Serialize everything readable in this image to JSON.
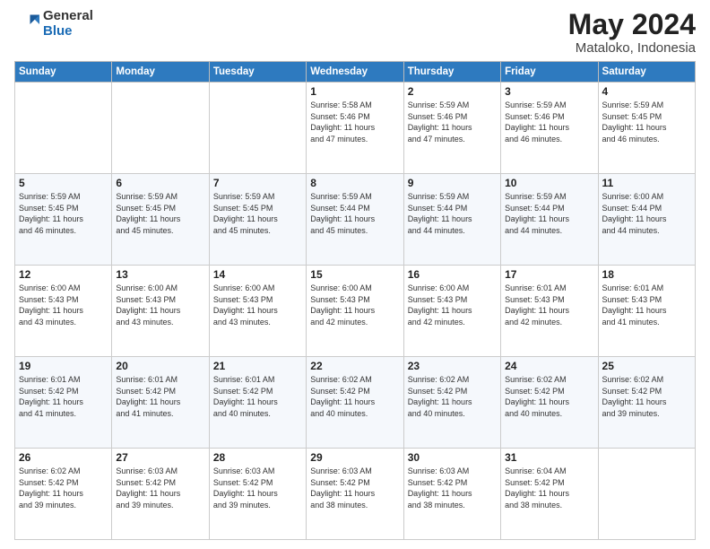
{
  "header": {
    "logo_general": "General",
    "logo_blue": "Blue",
    "title": "May 2024",
    "location": "Mataloko, Indonesia"
  },
  "days_of_week": [
    "Sunday",
    "Monday",
    "Tuesday",
    "Wednesday",
    "Thursday",
    "Friday",
    "Saturday"
  ],
  "weeks": [
    [
      {
        "day": "",
        "text": ""
      },
      {
        "day": "",
        "text": ""
      },
      {
        "day": "",
        "text": ""
      },
      {
        "day": "1",
        "text": "Sunrise: 5:58 AM\nSunset: 5:46 PM\nDaylight: 11 hours\nand 47 minutes."
      },
      {
        "day": "2",
        "text": "Sunrise: 5:59 AM\nSunset: 5:46 PM\nDaylight: 11 hours\nand 47 minutes."
      },
      {
        "day": "3",
        "text": "Sunrise: 5:59 AM\nSunset: 5:46 PM\nDaylight: 11 hours\nand 46 minutes."
      },
      {
        "day": "4",
        "text": "Sunrise: 5:59 AM\nSunset: 5:45 PM\nDaylight: 11 hours\nand 46 minutes."
      }
    ],
    [
      {
        "day": "5",
        "text": "Sunrise: 5:59 AM\nSunset: 5:45 PM\nDaylight: 11 hours\nand 46 minutes."
      },
      {
        "day": "6",
        "text": "Sunrise: 5:59 AM\nSunset: 5:45 PM\nDaylight: 11 hours\nand 45 minutes."
      },
      {
        "day": "7",
        "text": "Sunrise: 5:59 AM\nSunset: 5:45 PM\nDaylight: 11 hours\nand 45 minutes."
      },
      {
        "day": "8",
        "text": "Sunrise: 5:59 AM\nSunset: 5:44 PM\nDaylight: 11 hours\nand 45 minutes."
      },
      {
        "day": "9",
        "text": "Sunrise: 5:59 AM\nSunset: 5:44 PM\nDaylight: 11 hours\nand 44 minutes."
      },
      {
        "day": "10",
        "text": "Sunrise: 5:59 AM\nSunset: 5:44 PM\nDaylight: 11 hours\nand 44 minutes."
      },
      {
        "day": "11",
        "text": "Sunrise: 6:00 AM\nSunset: 5:44 PM\nDaylight: 11 hours\nand 44 minutes."
      }
    ],
    [
      {
        "day": "12",
        "text": "Sunrise: 6:00 AM\nSunset: 5:43 PM\nDaylight: 11 hours\nand 43 minutes."
      },
      {
        "day": "13",
        "text": "Sunrise: 6:00 AM\nSunset: 5:43 PM\nDaylight: 11 hours\nand 43 minutes."
      },
      {
        "day": "14",
        "text": "Sunrise: 6:00 AM\nSunset: 5:43 PM\nDaylight: 11 hours\nand 43 minutes."
      },
      {
        "day": "15",
        "text": "Sunrise: 6:00 AM\nSunset: 5:43 PM\nDaylight: 11 hours\nand 42 minutes."
      },
      {
        "day": "16",
        "text": "Sunrise: 6:00 AM\nSunset: 5:43 PM\nDaylight: 11 hours\nand 42 minutes."
      },
      {
        "day": "17",
        "text": "Sunrise: 6:01 AM\nSunset: 5:43 PM\nDaylight: 11 hours\nand 42 minutes."
      },
      {
        "day": "18",
        "text": "Sunrise: 6:01 AM\nSunset: 5:43 PM\nDaylight: 11 hours\nand 41 minutes."
      }
    ],
    [
      {
        "day": "19",
        "text": "Sunrise: 6:01 AM\nSunset: 5:42 PM\nDaylight: 11 hours\nand 41 minutes."
      },
      {
        "day": "20",
        "text": "Sunrise: 6:01 AM\nSunset: 5:42 PM\nDaylight: 11 hours\nand 41 minutes."
      },
      {
        "day": "21",
        "text": "Sunrise: 6:01 AM\nSunset: 5:42 PM\nDaylight: 11 hours\nand 40 minutes."
      },
      {
        "day": "22",
        "text": "Sunrise: 6:02 AM\nSunset: 5:42 PM\nDaylight: 11 hours\nand 40 minutes."
      },
      {
        "day": "23",
        "text": "Sunrise: 6:02 AM\nSunset: 5:42 PM\nDaylight: 11 hours\nand 40 minutes."
      },
      {
        "day": "24",
        "text": "Sunrise: 6:02 AM\nSunset: 5:42 PM\nDaylight: 11 hours\nand 40 minutes."
      },
      {
        "day": "25",
        "text": "Sunrise: 6:02 AM\nSunset: 5:42 PM\nDaylight: 11 hours\nand 39 minutes."
      }
    ],
    [
      {
        "day": "26",
        "text": "Sunrise: 6:02 AM\nSunset: 5:42 PM\nDaylight: 11 hours\nand 39 minutes."
      },
      {
        "day": "27",
        "text": "Sunrise: 6:03 AM\nSunset: 5:42 PM\nDaylight: 11 hours\nand 39 minutes."
      },
      {
        "day": "28",
        "text": "Sunrise: 6:03 AM\nSunset: 5:42 PM\nDaylight: 11 hours\nand 39 minutes."
      },
      {
        "day": "29",
        "text": "Sunrise: 6:03 AM\nSunset: 5:42 PM\nDaylight: 11 hours\nand 38 minutes."
      },
      {
        "day": "30",
        "text": "Sunrise: 6:03 AM\nSunset: 5:42 PM\nDaylight: 11 hours\nand 38 minutes."
      },
      {
        "day": "31",
        "text": "Sunrise: 6:04 AM\nSunset: 5:42 PM\nDaylight: 11 hours\nand 38 minutes."
      },
      {
        "day": "",
        "text": ""
      }
    ]
  ]
}
